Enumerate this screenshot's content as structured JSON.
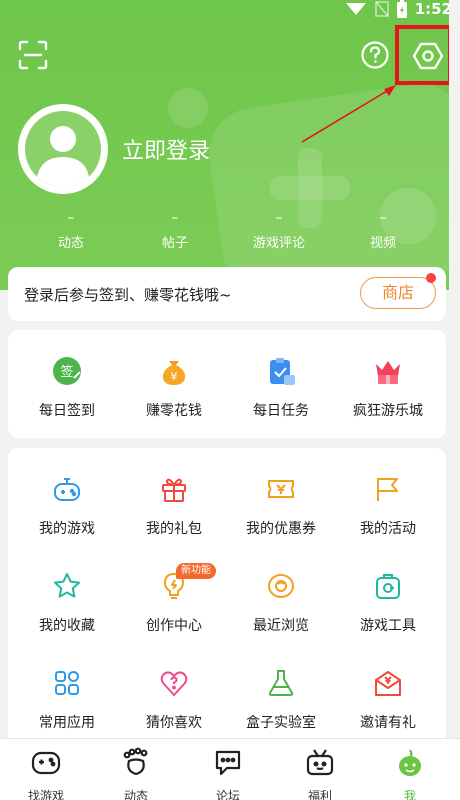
{
  "status_bar": {
    "time": "1:52"
  },
  "profile": {
    "login_label": "立即登录",
    "stats": [
      {
        "value": "–",
        "label": "动态"
      },
      {
        "value": "–",
        "label": "帖子"
      },
      {
        "value": "–",
        "label": "游戏评论"
      },
      {
        "value": "–",
        "label": "视频"
      }
    ]
  },
  "signin_bar": {
    "text": "登录后参与签到、赚零花钱哦~",
    "shop_label": "商店"
  },
  "quick_actions": [
    {
      "label": "每日签到",
      "icon": "sign-in-icon",
      "icon_text": "签"
    },
    {
      "label": "赚零花钱",
      "icon": "money-bag-icon",
      "icon_text": "¥"
    },
    {
      "label": "每日任务",
      "icon": "task-clipboard-icon"
    },
    {
      "label": "疯狂游乐城",
      "icon": "crown-gift-icon"
    }
  ],
  "features": [
    {
      "label": "我的游戏",
      "icon": "gamepad-icon"
    },
    {
      "label": "我的礼包",
      "icon": "gift-icon"
    },
    {
      "label": "我的优惠券",
      "icon": "coupon-icon"
    },
    {
      "label": "我的活动",
      "icon": "flag-icon"
    },
    {
      "label": "我的收藏",
      "icon": "star-icon"
    },
    {
      "label": "创作中心",
      "icon": "bulb-icon"
    },
    {
      "label": "最近浏览",
      "icon": "eye-icon"
    },
    {
      "label": "游戏工具",
      "icon": "toolbox-icon"
    },
    {
      "label": "常用应用",
      "icon": "apps-grid-icon"
    },
    {
      "label": "猜你喜欢",
      "icon": "heart-question-icon"
    },
    {
      "label": "盒子实验室",
      "icon": "flask-icon"
    },
    {
      "label": "邀请有礼",
      "icon": "invite-envelope-icon"
    }
  ],
  "new_badge": "新功能",
  "bottom_nav": [
    {
      "label": "找游戏",
      "icon": "controller-icon",
      "active": false
    },
    {
      "label": "动态",
      "icon": "footprint-icon",
      "active": false
    },
    {
      "label": "论坛",
      "icon": "chat-bubble-icon",
      "active": false
    },
    {
      "label": "福利",
      "icon": "gift-box-icon",
      "active": false
    },
    {
      "label": "我",
      "icon": "me-mascot-icon",
      "active": true
    }
  ],
  "colors": {
    "brand_green": "#6ec64a",
    "highlight_red": "#e3161b",
    "shop_orange": "#ec8a2d",
    "active_green": "#55b932"
  }
}
